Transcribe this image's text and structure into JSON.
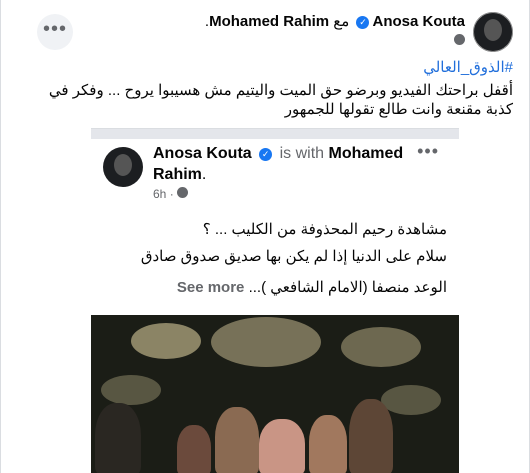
{
  "post": {
    "author": "Anosa Kouta",
    "with_word": "مع",
    "tagged": "Mohamed Rahim",
    "hashtag": "#الذوق_العالي",
    "text_line1": "أقفل براحتك الفيديو وبرضو حق الميت واليتيم مش هسيبوا يروح ... وفكر في",
    "text_line2": "كذبة مقنعة وانت طالع تقولها للجمهور",
    "privacy_icon": "globe-icon",
    "more_icon": "more-horizontal-icon"
  },
  "shared": {
    "author": "Anosa Kouta",
    "is_with": "is with",
    "tagged": "Mohamed Rahim",
    "time": "6h",
    "line1": "مشاهدة رحيم المحذوفة من الكليب ... ؟",
    "line2": "سلام على الدنيا إذا لم يكن بها صديق صدوق صادق",
    "line3": "الوعد منصفا (الامام الشافعي )...",
    "see_more": "See more"
  },
  "colors": {
    "link": "#216fdb",
    "verified": "#1877f2",
    "muted": "#65676b",
    "text": "#050505"
  }
}
